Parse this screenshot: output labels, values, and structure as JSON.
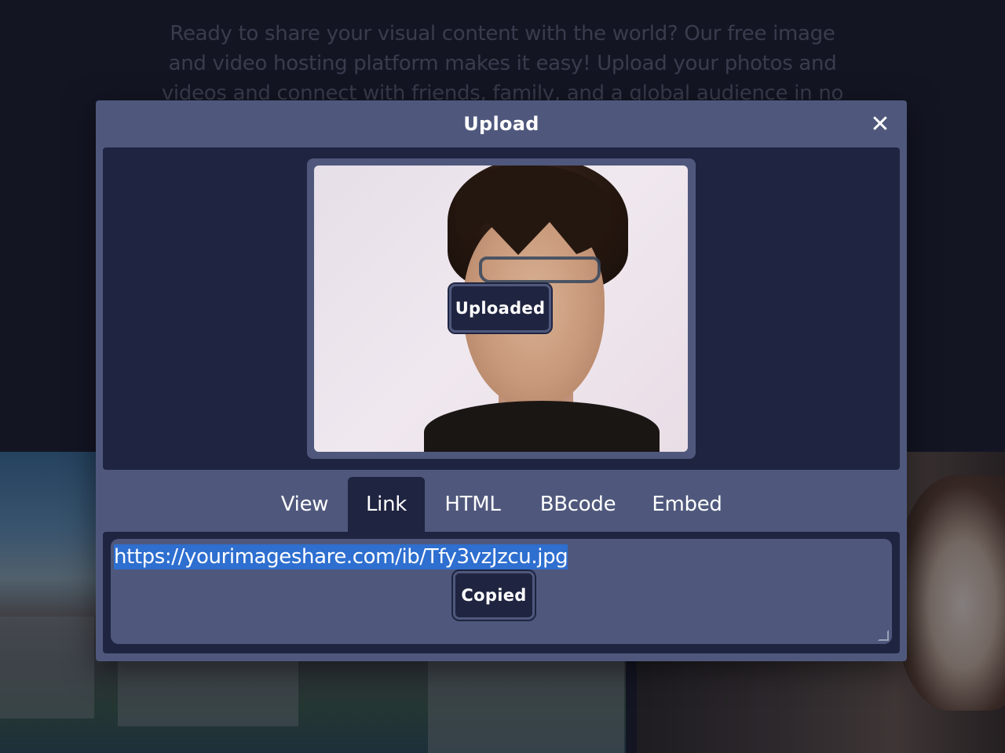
{
  "background": {
    "intro_text": "Ready to share your visual content with the world? Our free image and video hosting platform makes it easy! Upload your photos and videos and connect with friends, family, and a global audience in no"
  },
  "modal": {
    "title": "Upload",
    "close_icon": "close-icon",
    "preview_status": "Uploaded",
    "tabs": [
      {
        "label": "View",
        "active": false
      },
      {
        "label": "Link",
        "active": true
      },
      {
        "label": "HTML",
        "active": false
      },
      {
        "label": "BBcode",
        "active": false
      },
      {
        "label": "Embed",
        "active": false
      }
    ],
    "link_value": "https://yourimageshare.com/ib/Tfy3vzJzcu.jpg",
    "copy_status": "Copied"
  }
}
